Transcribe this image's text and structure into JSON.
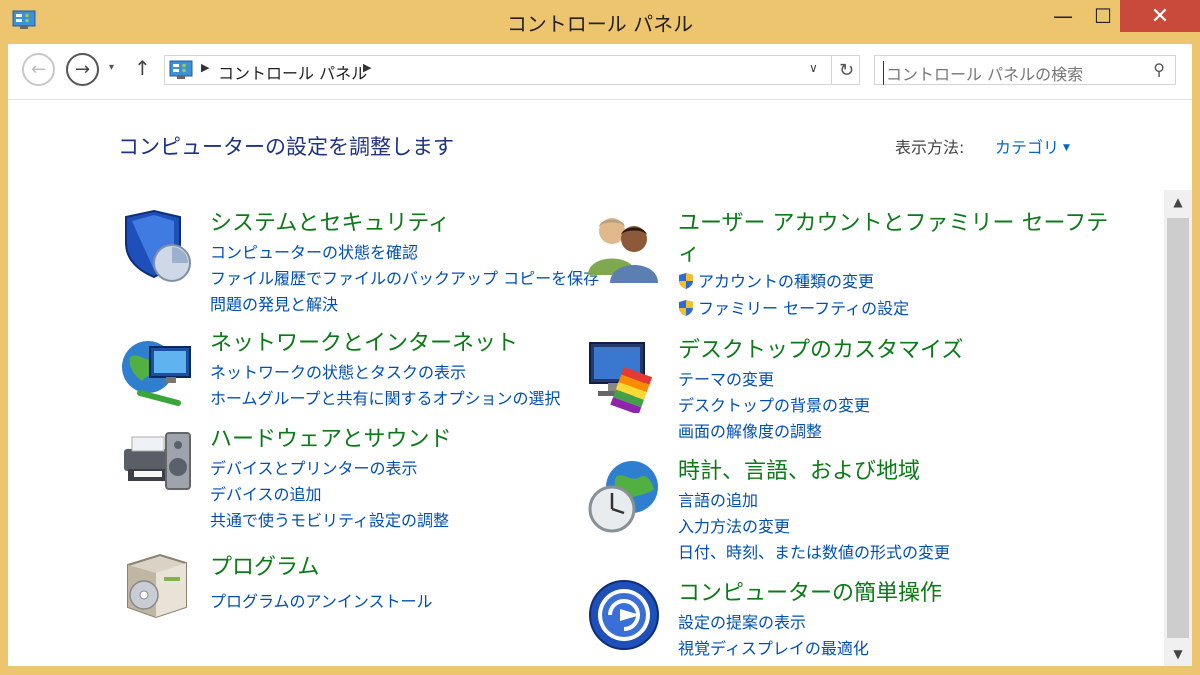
{
  "window": {
    "title": "コントロール パネル",
    "minimize": "—",
    "maximize": "☐",
    "close": "✕"
  },
  "nav": {
    "back": "←",
    "forward": "→",
    "recent": "▾",
    "up": "↑"
  },
  "address": {
    "sep1": "▶",
    "path": "コントロール パネル",
    "sep2": "▶",
    "dropdown": "∨",
    "refresh": "↻"
  },
  "search": {
    "placeholder": "コントロール パネルの検索",
    "icon": "⚲"
  },
  "main": {
    "heading": "コンピューターの設定を調整します",
    "view_label": "表示方法:",
    "view_value": "カテゴリ",
    "view_caret": "▼"
  },
  "categories": [
    {
      "title": "システムとセキュリティ",
      "links": [
        "コンピューターの状態を確認",
        "ファイル履歴でファイルのバックアップ コピーを保存",
        "問題の発見と解決"
      ]
    },
    {
      "title": "ネットワークとインターネット",
      "links": [
        "ネットワークの状態とタスクの表示",
        "ホームグループと共有に関するオプションの選択"
      ]
    },
    {
      "title": "ハードウェアとサウンド",
      "links": [
        "デバイスとプリンターの表示",
        "デバイスの追加",
        "共通で使うモビリティ設定の調整"
      ]
    },
    {
      "title": "プログラム",
      "links": [
        "プログラムのアンインストール"
      ]
    },
    {
      "title_line1": "ユーザー アカウントとファミリー セーフテ",
      "title_line2": "ィ",
      "links": [
        "アカウントの種類の変更",
        "ファミリー セーフティの設定"
      ]
    },
    {
      "title": "デスクトップのカスタマイズ",
      "links": [
        "テーマの変更",
        "デスクトップの背景の変更",
        "画面の解像度の調整"
      ]
    },
    {
      "title": "時計、言語、および地域",
      "links": [
        "言語の追加",
        "入力方法の変更",
        "日付、時刻、または数値の形式の変更"
      ]
    },
    {
      "title": "コンピューターの簡単操作",
      "links": [
        "設定の提案の表示",
        "視覚ディスプレイの最適化"
      ]
    }
  ],
  "scrollbar": {
    "up": "▲",
    "down": "▼"
  }
}
